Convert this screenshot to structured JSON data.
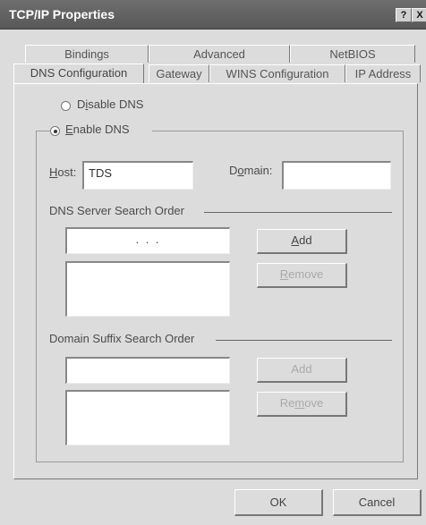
{
  "window": {
    "title": "TCP/IP Properties",
    "help_glyph": "?",
    "close_glyph": "X"
  },
  "tabs_back": [
    "Bindings",
    "Advanced",
    "NetBIOS"
  ],
  "tabs_front": [
    "DNS Configuration",
    "Gateway",
    "WINS Configuration",
    "IP Address"
  ],
  "dns": {
    "disable_label_pre": "D",
    "disable_label_u": "i",
    "disable_label_post": "sable DNS",
    "enable_label_u": "E",
    "enable_label_post": "nable DNS",
    "selected": "enable",
    "host_label_u": "H",
    "host_label_post": "ost:",
    "host_value": "TDS",
    "domain_label_pre": "D",
    "domain_label_u": "o",
    "domain_label_post": "main:",
    "domain_value": "",
    "server_order_label": "DNS Server Search Order",
    "ip_dots": ".      .      .",
    "add_label_u": "A",
    "add_label_post": "dd",
    "remove_label_u": "R",
    "remove_label_post": "emove",
    "suffix_order_label": "Domain Suffix Search Order",
    "suffix_add_label": "Add",
    "suffix_remove_label_pre": "Re",
    "suffix_remove_label_u": "m",
    "suffix_remove_label_post": "ove"
  },
  "footer": {
    "ok_label": "OK",
    "cancel_label": "Cancel"
  }
}
